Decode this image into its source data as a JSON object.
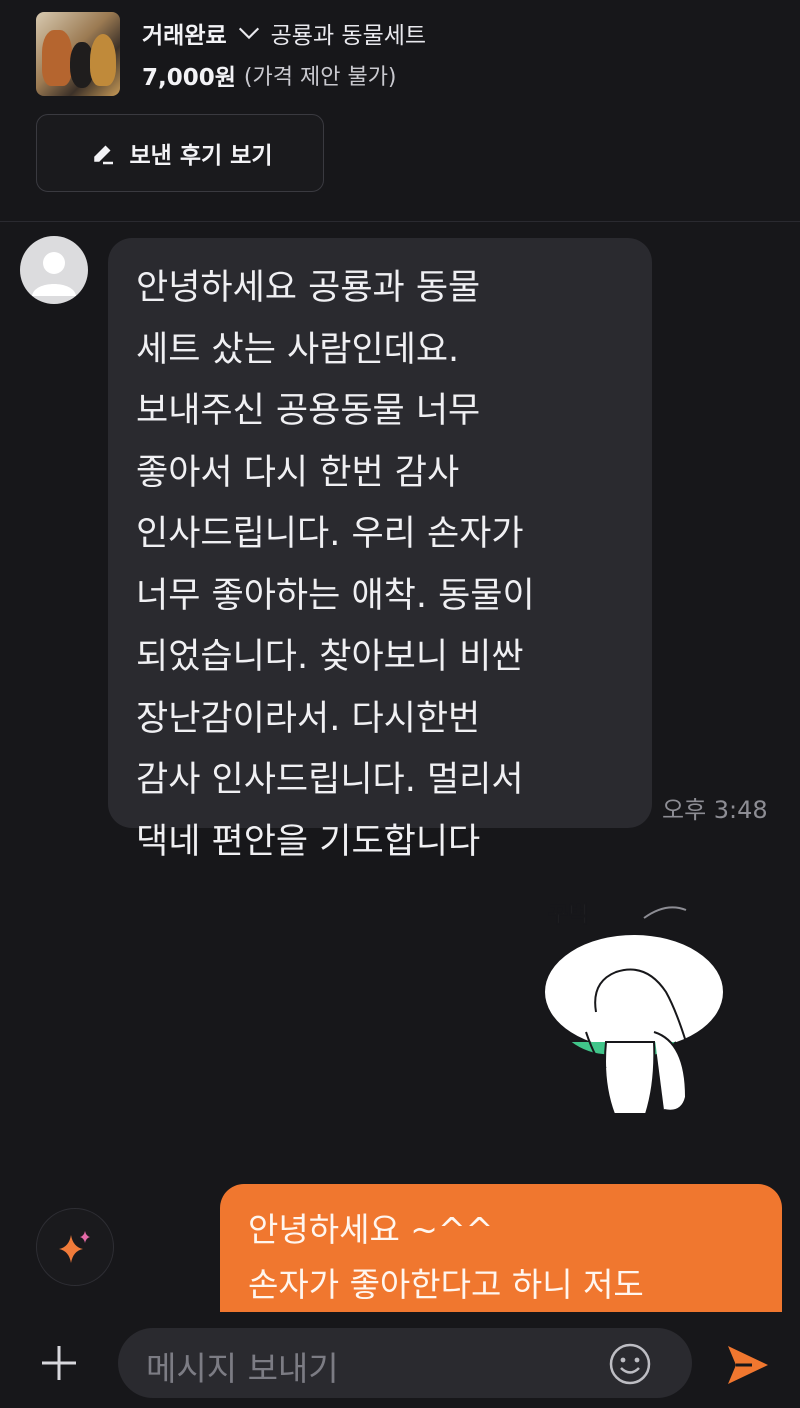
{
  "header": {
    "trade_status": "거래완료",
    "product_title": "공룡과 동물세트",
    "price": "7,000원",
    "price_note": "(가격 제안 불가)",
    "review_button_label": "보낸 후기 보기"
  },
  "messages": {
    "incoming": {
      "lines": [
        "안녕하세요 공룡과 동물",
        "세트 샀는 사람인데요.",
        "보내주신 공용동물 너무",
        "좋아서 다시 한번 감사",
        "인사드립니다. 우리 손자가",
        "너무 좋아하는 애착. 동물이",
        "되었습니다. 찾아보니 비싼",
        "장난감이라서. 다시한번",
        "감사 인사드립니다. 멀리서",
        "댁네 편안을 기도합니다"
      ],
      "time": "오후 3:48"
    },
    "sticker": {
      "text": "꾸벅"
    },
    "outgoing": {
      "lines": [
        "안녕하세요 ~^^",
        "손자가 좋아한다고 하니 저도"
      ]
    }
  },
  "input": {
    "placeholder": "메시지 보내기"
  },
  "colors": {
    "background": "#17171a",
    "incoming_bubble": "#2a2a2f",
    "outgoing_bubble": "#f0772f",
    "send_icon": "#f0772f"
  },
  "icons": {
    "status_dropdown": "chevron-down-icon",
    "review": "pencil-icon",
    "avatar": "user-icon",
    "ai": "sparkle-icon",
    "add": "plus-icon",
    "emoji": "smiley-icon",
    "send": "send-icon"
  }
}
